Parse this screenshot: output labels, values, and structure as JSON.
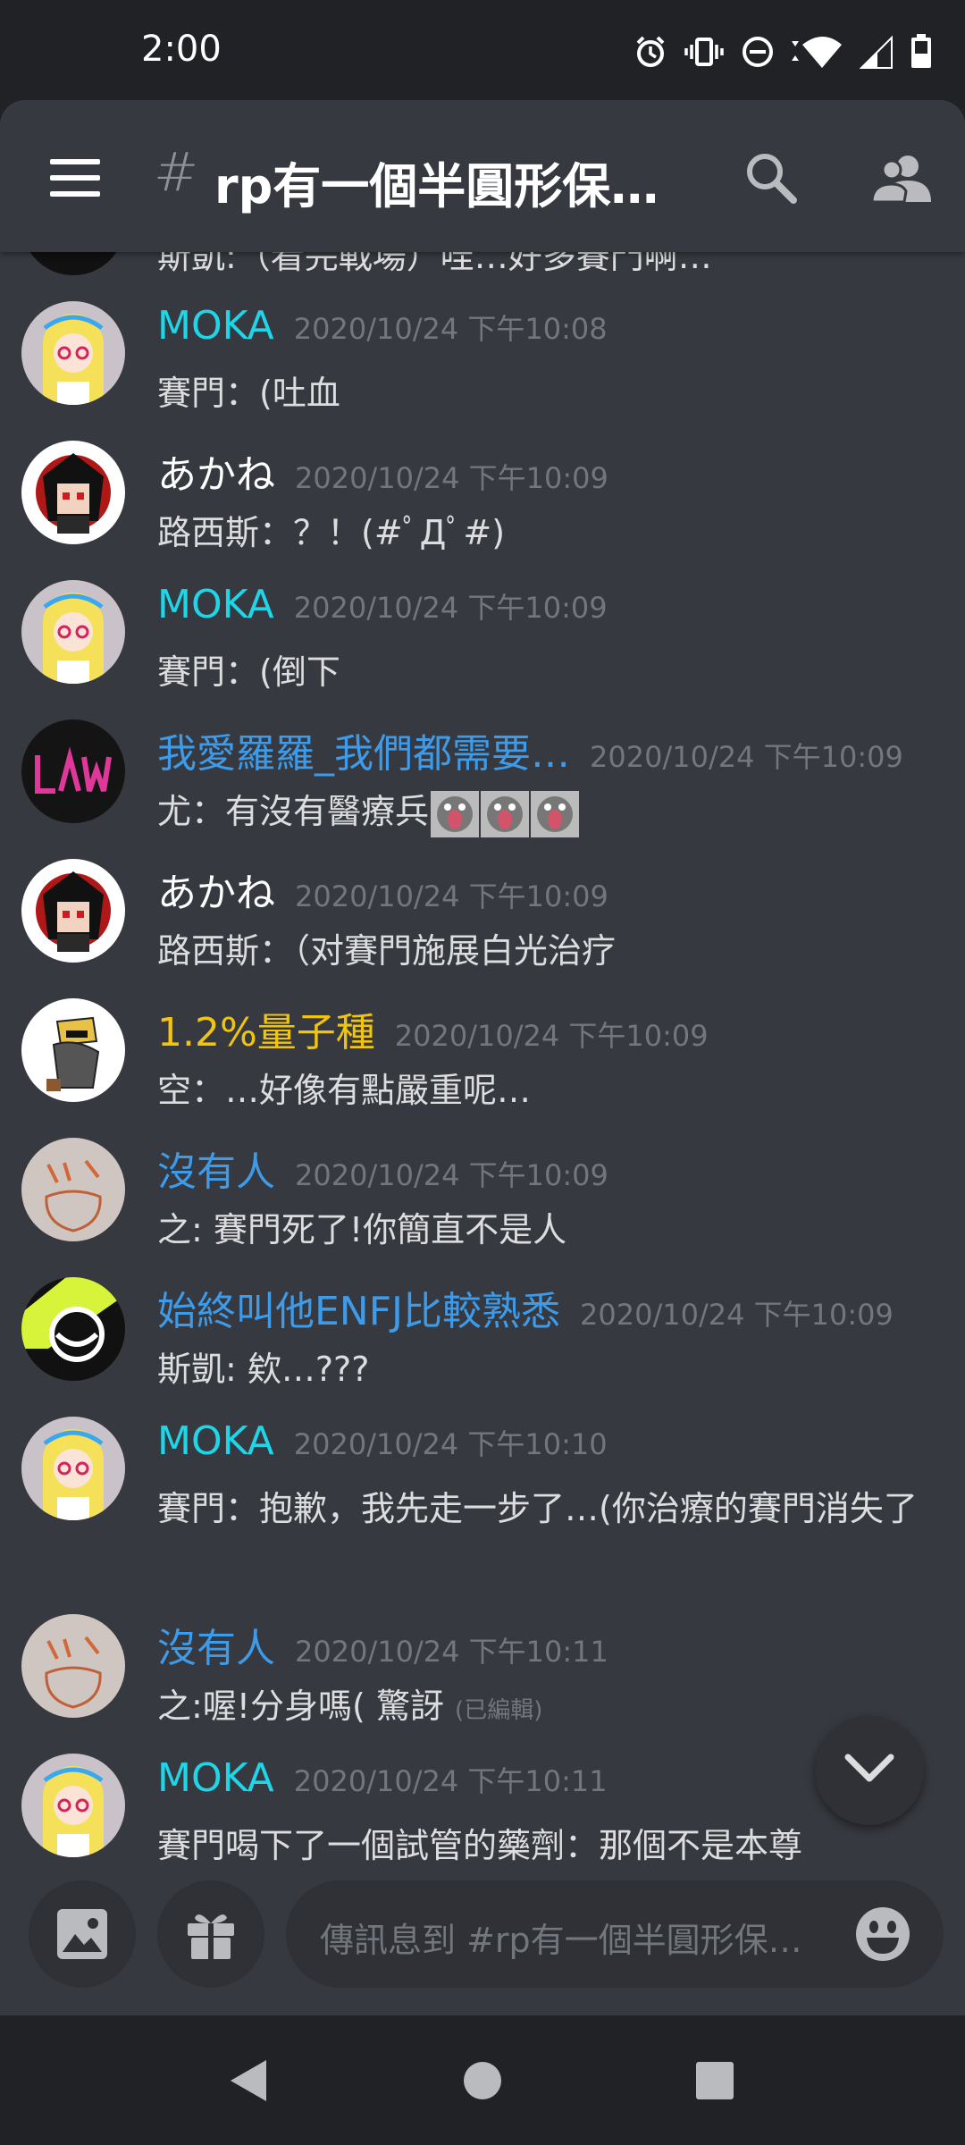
{
  "status_bar": {
    "time": "2:00"
  },
  "header": {
    "channel_name": "rp有一個半圓形保…"
  },
  "partial_message_text": "斯凱:（看完戰場）哇…好多賽門啊…",
  "messages": [
    {
      "author": "MOKA",
      "color": "#1fd6e8",
      "timestamp": "2020/10/24 下午10:08",
      "text": "賽門：(吐血",
      "avatar": "moka-avatar"
    },
    {
      "author": "あかね",
      "color": "#ffffff",
      "timestamp": "2020/10/24 下午10:09",
      "text": "路西斯：？！(#ﾟДﾟ#)",
      "avatar": "akane-avatar"
    },
    {
      "author": "MOKA",
      "color": "#1fd6e8",
      "timestamp": "2020/10/24 下午10:09",
      "text": "賽門：(倒下",
      "avatar": "moka-avatar"
    },
    {
      "author": "我愛羅羅_我們都需要…",
      "color": "#3d9be9",
      "timestamp": "2020/10/24 下午10:09",
      "text": "尤：有沒有醫療兵",
      "avatar": "law-avatar"
    },
    {
      "author": "あかね",
      "color": "#ffffff",
      "timestamp": "2020/10/24 下午10:09",
      "text": "路西斯：（对賽門施展白光治疗",
      "avatar": "akane-avatar"
    },
    {
      "author": "1.2%量子種",
      "color": "#f1c40f",
      "timestamp": "2020/10/24 下午10:09",
      "text": "空：…好像有點嚴重呢…",
      "avatar": "quantum-avatar"
    },
    {
      "author": "沒有人",
      "color": "#3d9be9",
      "timestamp": "2020/10/24 下午10:09",
      "text": "之: 賽門死了!你簡直不是人",
      "avatar": "nobody-avatar"
    },
    {
      "author": "始終叫他ENFJ比較熟悉",
      "color": "#3d9be9",
      "timestamp": "2020/10/24 下午10:09",
      "text": "斯凱: 欸…???",
      "avatar": "eye-avatar"
    },
    {
      "author": "MOKA",
      "color": "#1fd6e8",
      "timestamp": "2020/10/24 下午10:10",
      "text": "賽門：抱歉，我先走一步了…(你治療的賽門消失了",
      "avatar": "moka-avatar"
    },
    {
      "author": "沒有人",
      "color": "#3d9be9",
      "timestamp": "2020/10/24 下午10:11",
      "text": "之:喔!分身嗎( 驚訝",
      "edited": "(已編輯)",
      "avatar": "nobody-avatar"
    },
    {
      "author": "MOKA",
      "color": "#1fd6e8",
      "timestamp": "2020/10/24 下午10:11",
      "text": "賽門喝下了一個試管的藥劑：那個不是本尊",
      "avatar": "moka-avatar"
    }
  ],
  "composer": {
    "placeholder": "傳訊息到 #rp有一個半圓形保…"
  }
}
